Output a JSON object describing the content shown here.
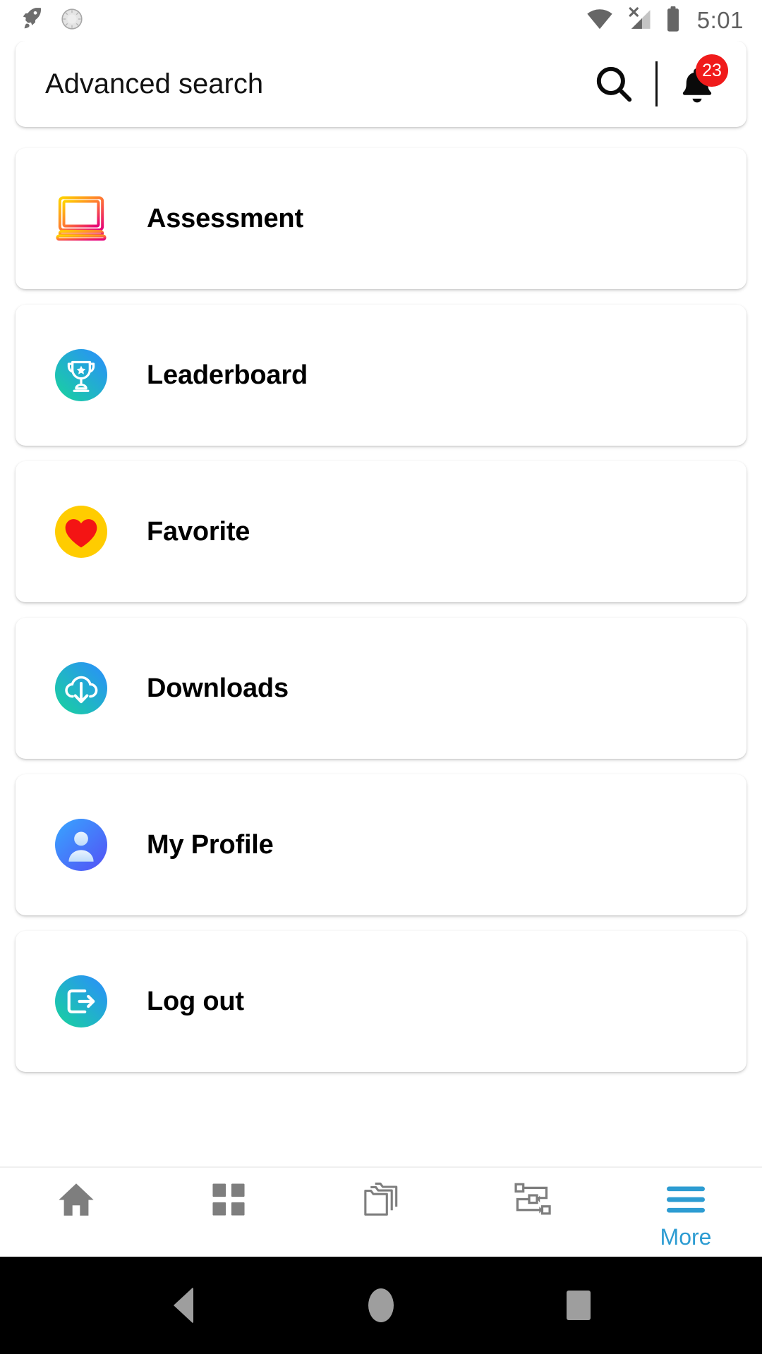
{
  "status_bar": {
    "time": "5:01",
    "left_icons": [
      "rocket-icon",
      "clock-icon"
    ],
    "right_icons": [
      "wifi-icon",
      "cellular-no-signal-icon",
      "battery-icon"
    ]
  },
  "search": {
    "value": "Advanced search",
    "placeholder": "Advanced search",
    "search_icon": "search-icon",
    "notification_icon": "bell-icon",
    "notification_count": "23",
    "badge_color": "#F01B1B"
  },
  "menu": {
    "items": [
      {
        "label": "Assessment",
        "icon": "monitor-outline-icon",
        "icon_style": "gradient-outline",
        "colors": [
          "#FFD400",
          "#E6007A"
        ]
      },
      {
        "label": "Leaderboard",
        "icon": "trophy-icon",
        "icon_style": "gradient-circle",
        "colors": [
          "#1ED39A",
          "#2B8CFF"
        ]
      },
      {
        "label": "Favorite",
        "icon": "heart-icon",
        "icon_style": "solid-circle",
        "colors": [
          "#FFCC00",
          "#F01B1B"
        ]
      },
      {
        "label": "Downloads",
        "icon": "cloud-download-icon",
        "icon_style": "gradient-circle",
        "colors": [
          "#1ED39A",
          "#2B8CFF"
        ]
      },
      {
        "label": "My Profile",
        "icon": "user-icon",
        "icon_style": "gradient-circle",
        "colors": [
          "#3D9BFF",
          "#5B5BFF"
        ]
      },
      {
        "label": "Log out",
        "icon": "logout-icon",
        "icon_style": "gradient-circle",
        "colors": [
          "#1ED39A",
          "#2B8CFF"
        ]
      }
    ]
  },
  "bottom_nav": {
    "active_color": "#2D9CD2",
    "inactive_color": "#7E7E7E",
    "items": [
      {
        "label": "",
        "icon": "home-icon",
        "active": false
      },
      {
        "label": "",
        "icon": "grid-icon",
        "active": false
      },
      {
        "label": "",
        "icon": "folders-icon",
        "active": false
      },
      {
        "label": "",
        "icon": "workflow-icon",
        "active": false
      },
      {
        "label": "More",
        "icon": "hamburger-menu-icon",
        "active": true
      }
    ]
  },
  "android_nav": {
    "back": "back-button",
    "home": "home-button",
    "recents": "recents-button"
  }
}
